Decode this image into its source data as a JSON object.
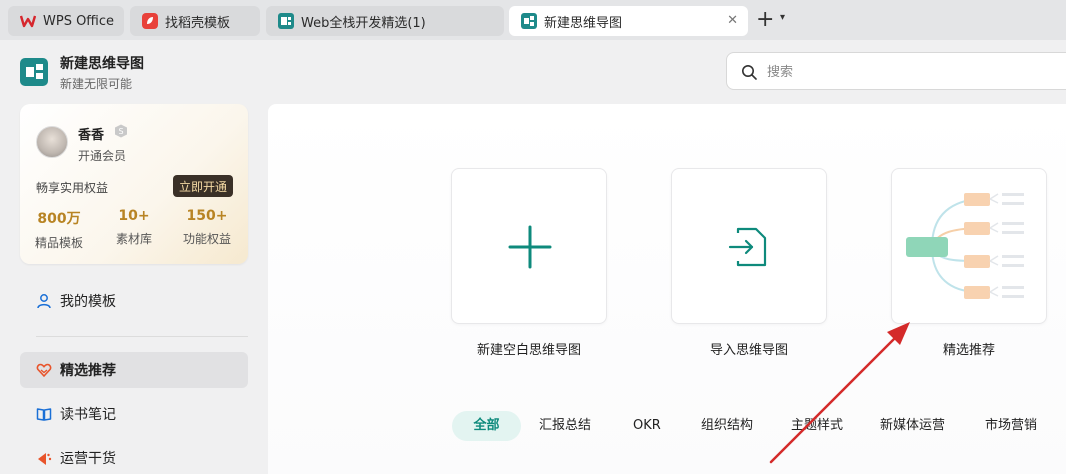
{
  "tabs": [
    {
      "label": "WPS Office",
      "icon": "wps-logo-icon"
    },
    {
      "label": "找稻壳模板",
      "icon": "docer-icon"
    },
    {
      "label": "Web全栈开发精选(1)",
      "icon": "document-icon"
    },
    {
      "label": "新建思维导图",
      "icon": "mindmap-icon",
      "active": true
    }
  ],
  "app": {
    "title": "新建思维导图",
    "subtitle": "新建无限可能"
  },
  "search": {
    "placeholder": "搜索"
  },
  "member": {
    "name": "香香",
    "status": "开通会员",
    "benefits_text": "畅享实用权益",
    "activate_label": "立即开通",
    "stats": [
      {
        "value": "800万",
        "label": "精品模板"
      },
      {
        "value": "10+",
        "label": "素材库"
      },
      {
        "value": "150+",
        "label": "功能权益"
      }
    ]
  },
  "menu": {
    "my_templates": "我的模板",
    "items": [
      {
        "label": "精选推荐",
        "icon": "heart-icon",
        "active": true
      },
      {
        "label": "读书笔记",
        "icon": "book-icon"
      },
      {
        "label": "运营干货",
        "icon": "megaphone-icon"
      }
    ]
  },
  "cards": [
    {
      "label": "新建空白思维导图",
      "icon": "plus-icon"
    },
    {
      "label": "导入思维导图",
      "icon": "import-file-icon"
    },
    {
      "label": "精选推荐",
      "icon": "mindmap-preview"
    }
  ],
  "categories": [
    "全部",
    "汇报总结",
    "OKR",
    "组织结构",
    "主题样式",
    "新媒体运营",
    "市场营销"
  ],
  "colors": {
    "accent": "#0e8a7c",
    "gold": "#b88424",
    "arrow": "#d42a2a"
  }
}
